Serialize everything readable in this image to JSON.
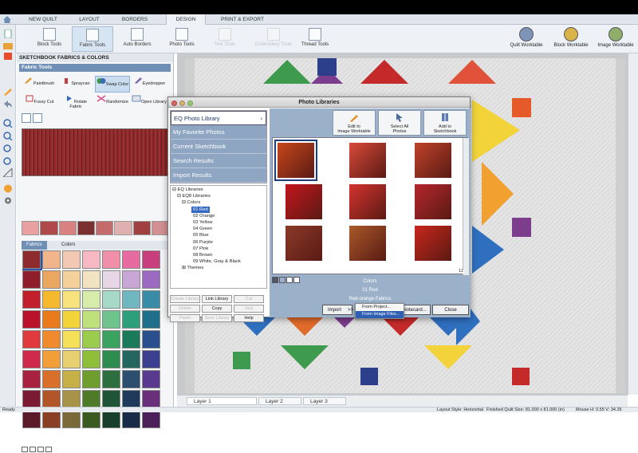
{
  "menubar": {
    "tabs": [
      {
        "label": "NEW QUILT"
      },
      {
        "label": "LAYOUT"
      },
      {
        "label": "BORDERS"
      },
      {
        "label": "DESIGN"
      },
      {
        "label": "PRINT & EXPORT"
      }
    ],
    "active": "DESIGN"
  },
  "ribbon": {
    "buttons": [
      {
        "label": "Block Tools",
        "state": "normal"
      },
      {
        "label": "Fabric Tools",
        "state": "selected"
      },
      {
        "label": "Auto Borders",
        "state": "normal"
      },
      {
        "label": "Photo Tools",
        "state": "normal"
      },
      {
        "label": "Text Tools",
        "state": "disabled"
      },
      {
        "label": "Embroidery Tools",
        "state": "disabled"
      },
      {
        "label": "Thread Tools",
        "state": "normal"
      }
    ],
    "worktables": [
      {
        "label": "Quilt Worktable",
        "color": "#7f95b8"
      },
      {
        "label": "Block Worktable",
        "color": "#d9b24a"
      },
      {
        "label": "Image Worktable",
        "color": "#8fae6a"
      }
    ]
  },
  "panel": {
    "title": "SKETCHBOOK FABRICS & COLORS",
    "section": "Fabric Tools",
    "tools": [
      {
        "label": "Paintbrush",
        "icon": "paintbrush-icon"
      },
      {
        "label": "Spraycan",
        "icon": "spraycan-icon"
      },
      {
        "label": "Swap Color",
        "icon": "swap-color-icon"
      },
      {
        "label": "Eyedropper",
        "icon": "eyedropper-icon"
      },
      {
        "label": "Fussy Cut",
        "icon": "fussy-cut-icon"
      },
      {
        "label": "Rotate Fabric",
        "icon": "rotate-fabric-icon"
      },
      {
        "label": "Randomize",
        "icon": "randomize-icon"
      },
      {
        "label": "Open Library",
        "icon": "open-library-icon"
      }
    ],
    "tabs": {
      "fabrics": "Fabrics",
      "colors": "Colors"
    },
    "swatch_colors": [
      "#8d2b2e",
      "#f2b58b",
      "#f4c9b4",
      "#f6b9c4",
      "#f08fa7",
      "#e76ba0",
      "#c93f7e",
      "#8f1d2a",
      "#e9a760",
      "#f4d19b",
      "#f1e3c2",
      "#e6d6e6",
      "#c8a6d6",
      "#9a6bc0",
      "#c21f2d",
      "#f5b92e",
      "#f7e27e",
      "#d7ecaa",
      "#a6d9c8",
      "#6fb8c2",
      "#3a8ca6",
      "#b9122a",
      "#e97b1c",
      "#f3d33a",
      "#bfe07a",
      "#6fc48e",
      "#2f9e7a",
      "#1f6f8b",
      "#e03a3e",
      "#ef8b2e",
      "#f6e05a",
      "#9ccc4d",
      "#3aa35f",
      "#1a7a5a",
      "#2a4f8f",
      "#cf2a4c",
      "#f29f3a",
      "#e8d070",
      "#8fbf3a",
      "#2e8c4e",
      "#25665e",
      "#3b3f8f",
      "#a8213f",
      "#d8702a",
      "#c8b048",
      "#6e9f2e",
      "#2d6e3e",
      "#2d4f6f",
      "#5a3a8f",
      "#7c1a33",
      "#b2552a",
      "#a89448",
      "#4f7a2a",
      "#1f5436",
      "#1f3a5a",
      "#6a2f7a",
      "#5c1a2a",
      "#8a4024",
      "#7a6a3a",
      "#3a5a22",
      "#17402c",
      "#182c48",
      "#4a1f5a"
    ],
    "strip_colors": [
      "#e8a0a0",
      "#b04a4a",
      "#d98080",
      "#7a3030",
      "#c46a6a",
      "#e0b0b0",
      "#a04040",
      "#d29090"
    ]
  },
  "dialog": {
    "title": "Photo Libraries",
    "nav": [
      {
        "label": "EQ Photo Library",
        "active": true,
        "chevron": "›"
      },
      {
        "label": "My Favorite Photos",
        "active": false
      },
      {
        "label": "Current Sketchbook",
        "active": false
      },
      {
        "label": "Search Results",
        "active": false
      },
      {
        "label": "Import Results",
        "active": false
      }
    ],
    "tree": {
      "root": "EQ Libraries",
      "lib": "EQ8 Libraries",
      "folder": "Colors",
      "items": [
        "01 Red",
        "02 Orange",
        "03 Yellow",
        "04 Green",
        "05 Blue",
        "06 Purple",
        "07 Pink",
        "08 Brown",
        "09 White, Gray & Black"
      ],
      "themes": "Themes",
      "selected": "01 Red"
    },
    "lib_buttons": [
      {
        "label": "Create Library",
        "enabled": false
      },
      {
        "label": "Link Library",
        "enabled": true
      },
      {
        "label": "Cut",
        "enabled": false
      },
      {
        "label": "Delete",
        "enabled": false
      },
      {
        "label": "Copy",
        "enabled": true
      },
      {
        "label": "Sort",
        "enabled": false
      },
      {
        "label": "Paste",
        "enabled": false
      },
      {
        "label": "Save Library",
        "enabled": false
      },
      {
        "label": "Help",
        "enabled": true
      }
    ],
    "actions": [
      {
        "label": "Edit to\nImage Worktable",
        "icon": "pencil-icon"
      },
      {
        "label": "Select All\nPhotos",
        "icon": "cursor-icon"
      },
      {
        "label": "Add to\nSketchbook",
        "icon": "book-icon"
      }
    ],
    "photo_colors": [
      "#c8471c",
      "#d94a3a",
      "#c0432a",
      "#c4161c",
      "#d5332f",
      "#b5262c",
      "#8a3a28",
      "#a85a28",
      "#c9261c"
    ],
    "page_count": "12",
    "info": {
      "line1": "Colors",
      "line2": "01 Red",
      "line3": "Red-orange Fabrics"
    },
    "import_label": "Import",
    "import_arrow": ">>",
    "notecard_label": "Notecard...",
    "close_label": "Close",
    "import_menu": [
      {
        "label": "From Project...",
        "highlighted": false
      },
      {
        "label": "From Image Files...",
        "highlighted": true
      }
    ]
  },
  "layers": [
    {
      "label": "Layer 1",
      "active": true
    },
    {
      "label": "Layer 2",
      "active": false
    },
    {
      "label": "Layer 3",
      "active": false
    }
  ],
  "status": {
    "ready": "Ready",
    "layout_style": "Layout Style: Horizontal",
    "quilt_size": "Finished Quilt Size: 81.000 x 81.000 (in)",
    "mouse": "Mouse   H:  0.55   V:  34.26"
  },
  "colors": {
    "accent": "#6f8fb5",
    "selection": "#3268c4",
    "dialog_panel": "#9bb0c9"
  }
}
